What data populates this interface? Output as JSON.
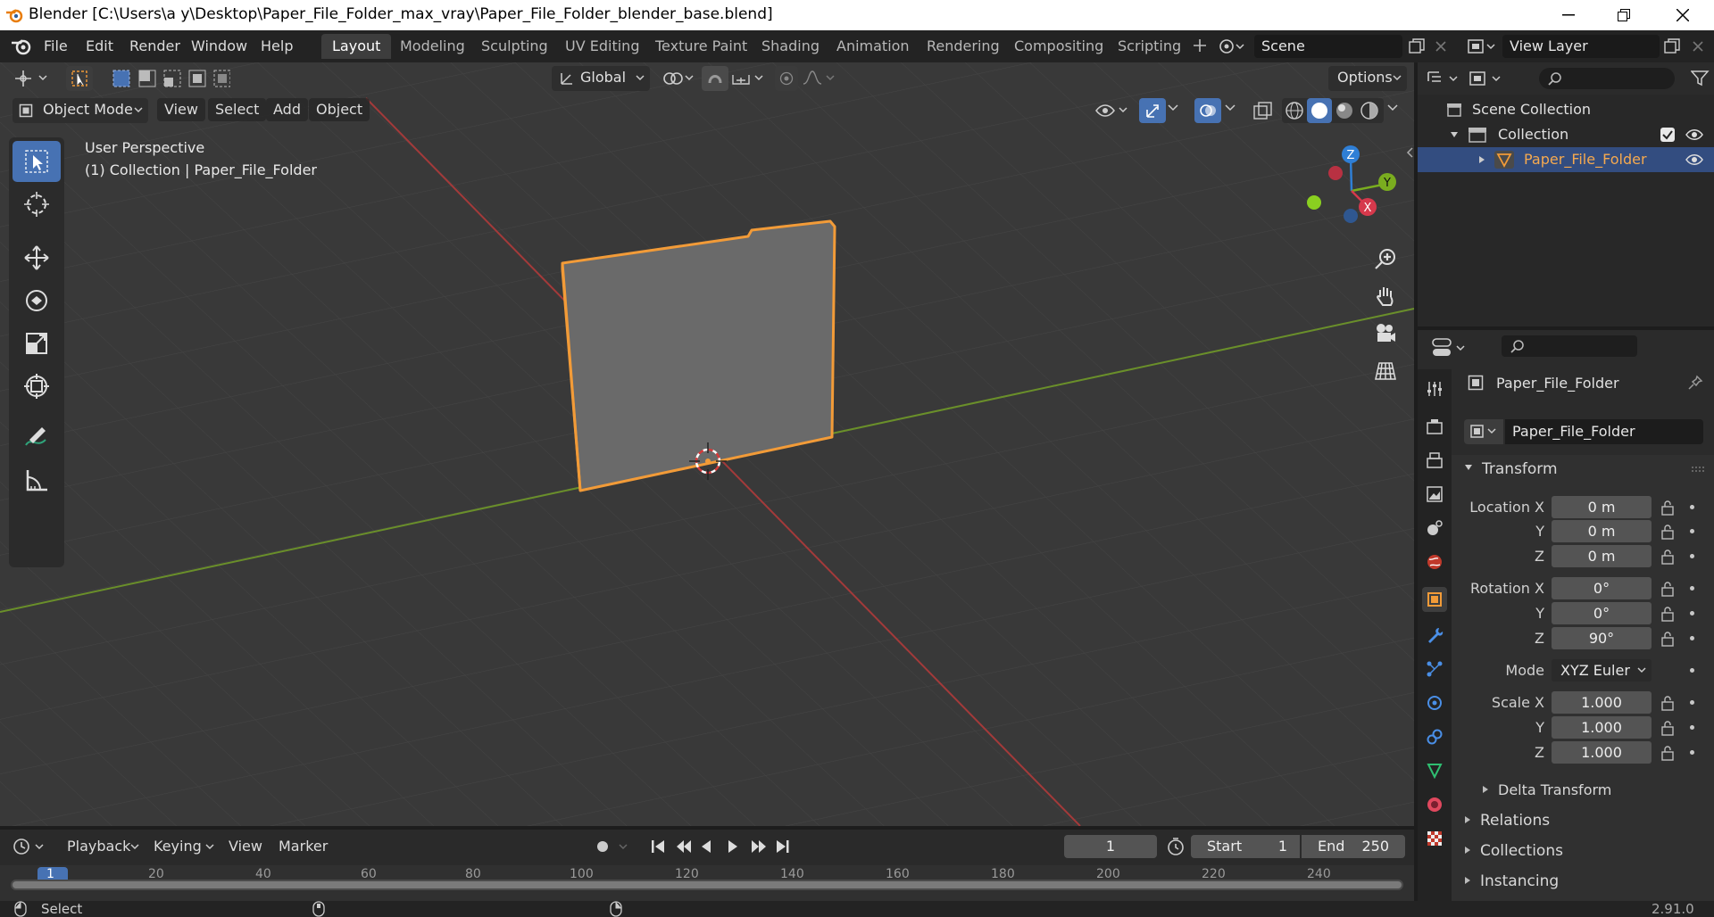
{
  "window": {
    "title": "Blender [C:\\Users\\a y\\Desktop\\Paper_File_Folder_max_vray\\Paper_File_Folder_blender_base.blend]"
  },
  "menu": [
    "File",
    "Edit",
    "Render",
    "Window",
    "Help"
  ],
  "workspaces": [
    "Layout",
    "Modeling",
    "Sculpting",
    "UV Editing",
    "Texture Paint",
    "Shading",
    "Animation",
    "Rendering",
    "Compositing",
    "Scripting"
  ],
  "active_workspace": "Layout",
  "scene": {
    "label": "Scene",
    "view_layer": "View Layer"
  },
  "tool_header": {
    "orientation": "Global",
    "options": "Options"
  },
  "viewport": {
    "mode": "Object Mode",
    "menus": [
      "View",
      "Select",
      "Add",
      "Object"
    ],
    "info_line1": "User Perspective",
    "info_line2": "(1) Collection | Paper_File_Folder",
    "gizmo": {
      "x": "X",
      "y": "Y",
      "z": "Z"
    }
  },
  "outliner": {
    "scene_collection": "Scene Collection",
    "collection": "Collection",
    "object": "Paper_File_Folder"
  },
  "properties": {
    "object_name": "Paper_File_Folder",
    "data_name": "Paper_File_Folder",
    "transform": {
      "title": "Transform",
      "location_label": "Location X",
      "rotation_label": "Rotation X",
      "scale_label": "Scale X",
      "y_label": "Y",
      "z_label": "Z",
      "location": [
        "0 m",
        "0 m",
        "0 m"
      ],
      "rotation": [
        "0°",
        "0°",
        "90°"
      ],
      "mode_label": "Mode",
      "mode": "XYZ Euler",
      "scale": [
        "1.000",
        "1.000",
        "1.000"
      ]
    },
    "sections": [
      "Delta Transform",
      "Relations",
      "Collections",
      "Instancing"
    ]
  },
  "timeline": {
    "menus": [
      "Playback",
      "Keying",
      "View",
      "Marker"
    ],
    "current_frame": "1",
    "start_label": "Start",
    "start": "1",
    "end_label": "End",
    "end": "250",
    "ticks": [
      "1",
      "20",
      "40",
      "60",
      "80",
      "100",
      "120",
      "140",
      "160",
      "180",
      "200",
      "220",
      "240"
    ]
  },
  "status": {
    "left": "Select",
    "version": "2.91.0"
  },
  "colors": {
    "accent": "#4772b3",
    "selection": "#f29b38",
    "x_axis": "#a33a3a",
    "y_axis": "#6a8f2a",
    "active_row": "#334d80"
  }
}
